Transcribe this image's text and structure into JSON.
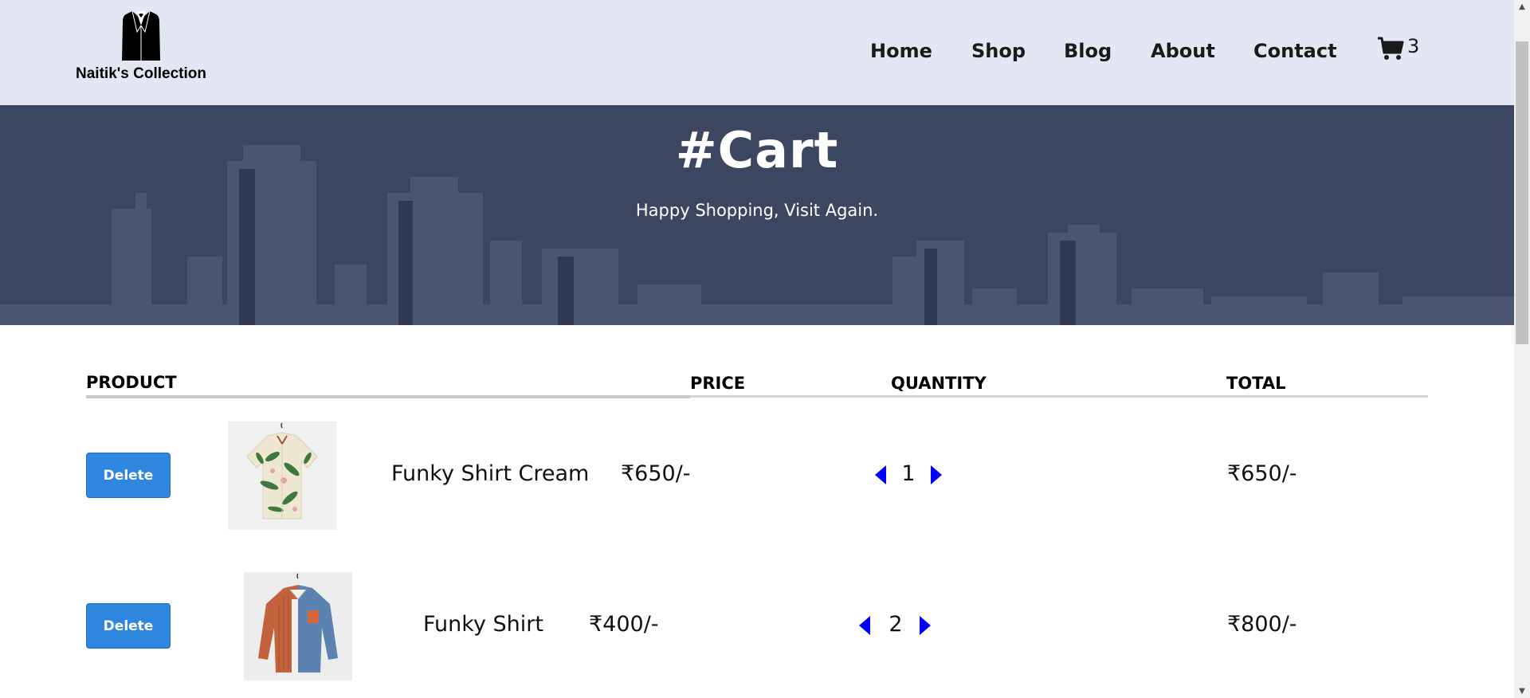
{
  "header": {
    "brand": "Naitik's Collection",
    "logo_icon": "suit-jacket-icon",
    "nav": [
      {
        "label": "Home"
      },
      {
        "label": "Shop"
      },
      {
        "label": "Blog"
      },
      {
        "label": "About"
      },
      {
        "label": "Contact"
      }
    ],
    "cart": {
      "icon": "shopping-cart-icon",
      "count": "3"
    }
  },
  "hero": {
    "title": "#Cart",
    "subtitle": "Happy Shopping, Visit Again."
  },
  "table": {
    "columns": {
      "product": "PRODUCT",
      "price": "PRICE",
      "quantity": "QUANTITY",
      "total": "TOTAL"
    },
    "rows": [
      {
        "delete_label": "Delete",
        "name": "Funky Shirt Cream",
        "price": "₹650/-",
        "quantity": "1",
        "total": "₹650/-",
        "image_icon": "floral-shirt-image"
      },
      {
        "delete_label": "Delete",
        "name": "Funky Shirt",
        "price": "₹400/-",
        "quantity": "2",
        "total": "₹800/-",
        "image_icon": "colorblock-shirt-image"
      }
    ]
  },
  "colors": {
    "header_bg": "#e3e6f3",
    "hero_bg": "#3b4660",
    "delete_button": "#2f86de",
    "qty_arrow": "#0000ff"
  }
}
